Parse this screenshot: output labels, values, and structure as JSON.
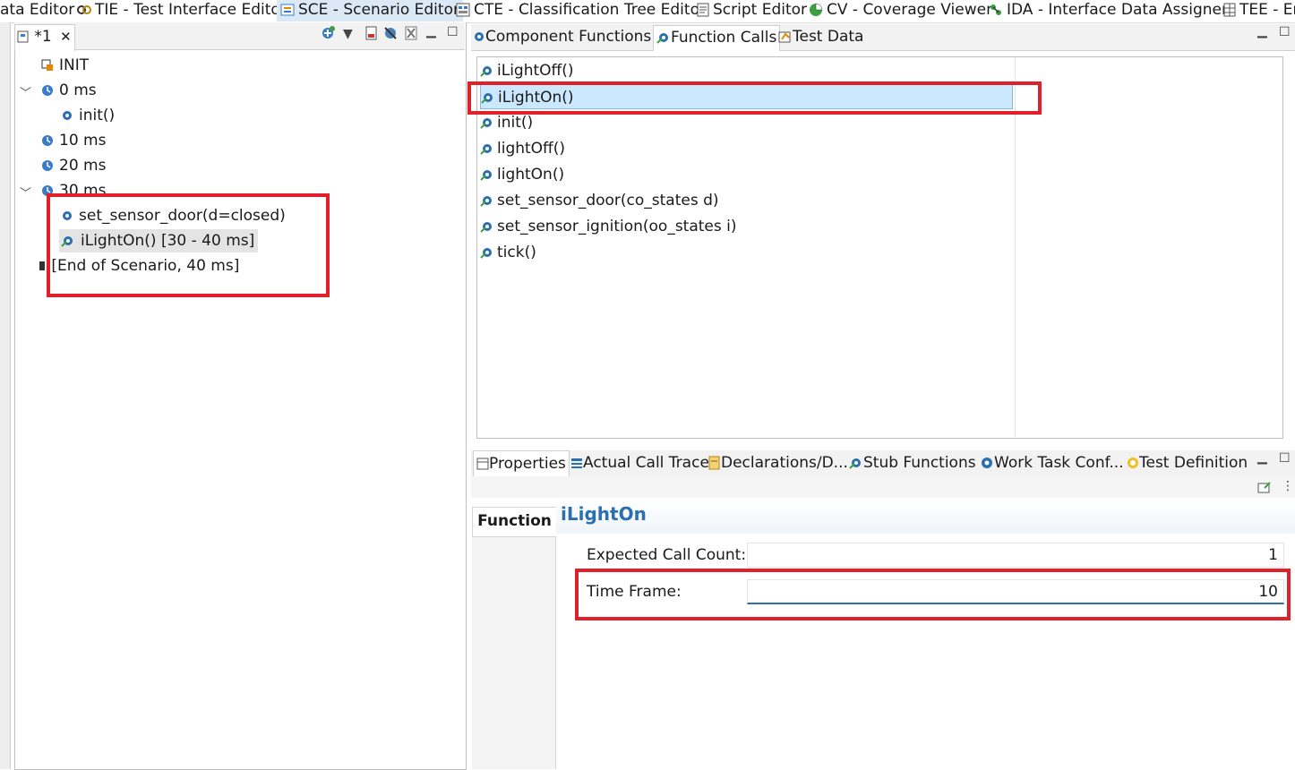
{
  "top_tabs": [
    {
      "label": "ata Editor",
      "icon": "editor-icon"
    },
    {
      "label": "TIE - Test Interface Editor",
      "icon": "link-icon"
    },
    {
      "label": "SCE - Scenario Editor",
      "icon": "scenario-icon"
    },
    {
      "label": "CTE - Classification Tree Editor",
      "icon": "tree-editor-icon"
    },
    {
      "label": "Script Editor",
      "icon": "script-icon"
    },
    {
      "label": "CV - Coverage Viewer",
      "icon": "pie-icon"
    },
    {
      "label": "IDA - Interface Data Assigner",
      "icon": "assigner-icon"
    },
    {
      "label": "TEE - Er",
      "icon": "grid-icon"
    }
  ],
  "scenario": {
    "tab_label": "*1",
    "tree": [
      {
        "label": "INIT",
        "icon": "init-icon"
      },
      {
        "label": "0 ms",
        "icon": "clock-icon"
      },
      {
        "label": "init()",
        "icon": "gear-icon"
      },
      {
        "label": "10 ms",
        "icon": "clock-icon"
      },
      {
        "label": "20 ms",
        "icon": "clock-icon"
      },
      {
        "label": "30 ms",
        "icon": "clock-icon"
      },
      {
        "label": "set_sensor_door(d=closed)",
        "icon": "gear-icon"
      },
      {
        "label": "iLightOn() [30 - 40 ms]",
        "icon": "gear-call-icon"
      },
      {
        "label": "[End of Scenario, 40 ms]",
        "icon": "stop-icon"
      }
    ]
  },
  "function_panel": {
    "tabs": [
      {
        "label": "Component Functions"
      },
      {
        "label": "Function Calls"
      },
      {
        "label": "Test Data"
      }
    ],
    "functions": [
      "iLightOff()",
      "iLightOn()",
      "init()",
      "lightOff()",
      "lightOn()",
      "set_sensor_door(co_states d)",
      "set_sensor_ignition(oo_states i)",
      "tick()"
    ],
    "selected": "iLightOn()"
  },
  "properties_panel": {
    "tabs": [
      {
        "label": "Properties"
      },
      {
        "label": "Actual Call Trace"
      },
      {
        "label": "Declarations/D..."
      },
      {
        "label": "Stub Functions"
      },
      {
        "label": "Work Task Conf..."
      },
      {
        "label": "Test Definition"
      }
    ],
    "side_tab": "Function",
    "title": "iLightOn",
    "fields": {
      "expected_call_count_label": "Expected Call Count:",
      "expected_call_count_value": "1",
      "time_frame_label": "Time Frame:",
      "time_frame_value": "10"
    }
  },
  "colors": {
    "highlight": "#e0202a",
    "selection": "#cce8ff",
    "title_blue": "#2a6fb0"
  }
}
